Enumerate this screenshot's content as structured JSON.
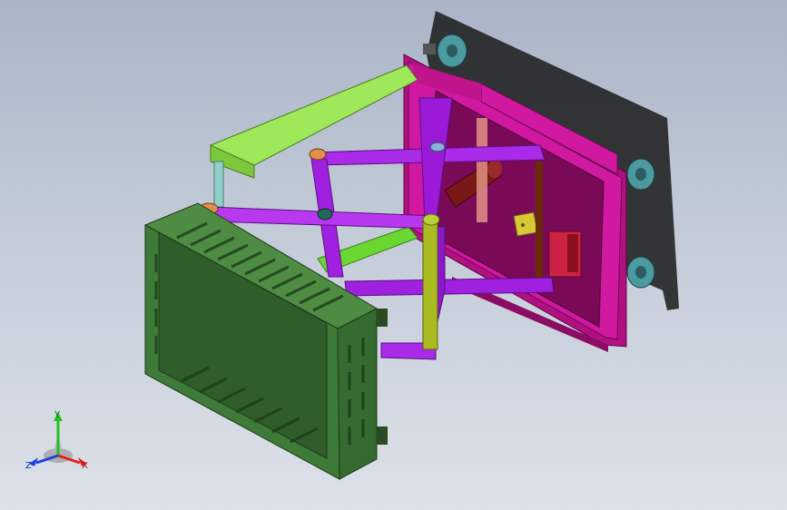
{
  "viewport": {
    "background_top": "#a9b4c6",
    "background_bottom": "#dde1e8"
  },
  "model": {
    "parts": {
      "base_plate": "#c0148c",
      "scissor_arms": "#a020e0",
      "crate": "#3e7a38",
      "side_rail": "#8ee04a",
      "cylinder": "#8a1a1a",
      "motor_box": "#cc2244",
      "sensor_box": "#d8c838",
      "caster_wheel": "#4a9aa0",
      "pivot_pin": "#e0904a"
    }
  },
  "triad": {
    "y_label": "Y",
    "x_label": "X",
    "z_label": "Z",
    "colors": {
      "x": "#e02020",
      "y": "#20c020",
      "z": "#2040e0"
    }
  }
}
